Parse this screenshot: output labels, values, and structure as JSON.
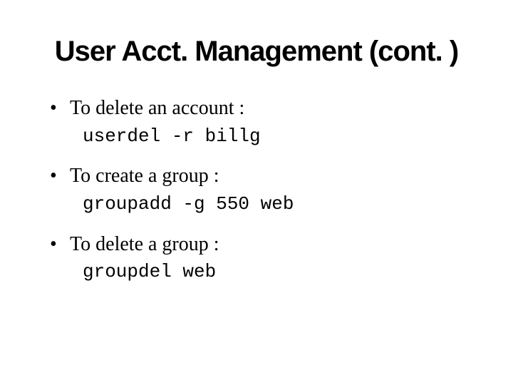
{
  "title": "User Acct. Management (cont. )",
  "items": [
    {
      "text": "To delete an account :",
      "command": "userdel -r billg"
    },
    {
      "text": "To create a group :",
      "command": "groupadd -g 550 web"
    },
    {
      "text": "To delete a group :",
      "command": "groupdel web"
    }
  ]
}
